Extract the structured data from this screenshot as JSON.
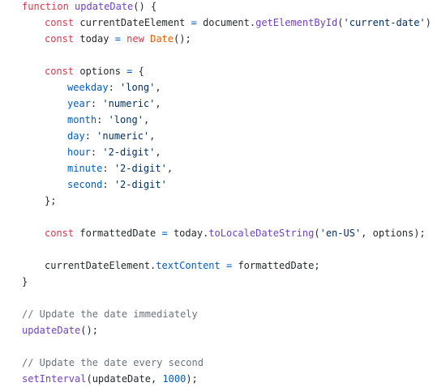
{
  "editor": {
    "lines": [
      {
        "indent": 1,
        "tokens": [
          {
            "t": "kw",
            "v": "function"
          },
          {
            "t": "txt",
            "v": " "
          },
          {
            "t": "fn",
            "v": "updateDate"
          },
          {
            "t": "txt",
            "v": "() {"
          }
        ]
      },
      {
        "indent": 2,
        "tokens": [
          {
            "t": "kw",
            "v": "const"
          },
          {
            "t": "txt",
            "v": " currentDateElement "
          },
          {
            "t": "op",
            "v": "="
          },
          {
            "t": "txt",
            "v": " document."
          },
          {
            "t": "fn",
            "v": "getElementById"
          },
          {
            "t": "txt",
            "v": "("
          },
          {
            "t": "str",
            "v": "'current-date'"
          },
          {
            "t": "txt",
            "v": ");"
          }
        ]
      },
      {
        "indent": 2,
        "tokens": [
          {
            "t": "kw",
            "v": "const"
          },
          {
            "t": "txt",
            "v": " today "
          },
          {
            "t": "op",
            "v": "="
          },
          {
            "t": "txt",
            "v": " "
          },
          {
            "t": "kw",
            "v": "new"
          },
          {
            "t": "txt",
            "v": " "
          },
          {
            "t": "cls",
            "v": "Date"
          },
          {
            "t": "txt",
            "v": "();"
          }
        ]
      },
      {
        "indent": 0,
        "tokens": []
      },
      {
        "indent": 2,
        "tokens": [
          {
            "t": "kw",
            "v": "const"
          },
          {
            "t": "txt",
            "v": " options "
          },
          {
            "t": "op",
            "v": "="
          },
          {
            "t": "txt",
            "v": " {"
          }
        ]
      },
      {
        "indent": 3,
        "tokens": [
          {
            "t": "prop",
            "v": "weekday"
          },
          {
            "t": "txt",
            "v": ": "
          },
          {
            "t": "str",
            "v": "'long'"
          },
          {
            "t": "txt",
            "v": ","
          }
        ]
      },
      {
        "indent": 3,
        "tokens": [
          {
            "t": "prop",
            "v": "year"
          },
          {
            "t": "txt",
            "v": ": "
          },
          {
            "t": "str",
            "v": "'numeric'"
          },
          {
            "t": "txt",
            "v": ","
          }
        ]
      },
      {
        "indent": 3,
        "tokens": [
          {
            "t": "prop",
            "v": "month"
          },
          {
            "t": "txt",
            "v": ": "
          },
          {
            "t": "str",
            "v": "'long'"
          },
          {
            "t": "txt",
            "v": ","
          }
        ]
      },
      {
        "indent": 3,
        "tokens": [
          {
            "t": "prop",
            "v": "day"
          },
          {
            "t": "txt",
            "v": ": "
          },
          {
            "t": "str",
            "v": "'numeric'"
          },
          {
            "t": "txt",
            "v": ","
          }
        ]
      },
      {
        "indent": 3,
        "tokens": [
          {
            "t": "prop",
            "v": "hour"
          },
          {
            "t": "txt",
            "v": ": "
          },
          {
            "t": "str",
            "v": "'2-digit'"
          },
          {
            "t": "txt",
            "v": ","
          }
        ]
      },
      {
        "indent": 3,
        "tokens": [
          {
            "t": "prop",
            "v": "minute"
          },
          {
            "t": "txt",
            "v": ": "
          },
          {
            "t": "str",
            "v": "'2-digit'"
          },
          {
            "t": "txt",
            "v": ","
          }
        ]
      },
      {
        "indent": 3,
        "tokens": [
          {
            "t": "prop",
            "v": "second"
          },
          {
            "t": "txt",
            "v": ": "
          },
          {
            "t": "str",
            "v": "'2-digit'"
          }
        ]
      },
      {
        "indent": 2,
        "tokens": [
          {
            "t": "txt",
            "v": "};"
          }
        ]
      },
      {
        "indent": 0,
        "tokens": []
      },
      {
        "indent": 2,
        "tokens": [
          {
            "t": "kw",
            "v": "const"
          },
          {
            "t": "txt",
            "v": " formattedDate "
          },
          {
            "t": "op",
            "v": "="
          },
          {
            "t": "txt",
            "v": " today."
          },
          {
            "t": "fn",
            "v": "toLocaleDateString"
          },
          {
            "t": "txt",
            "v": "("
          },
          {
            "t": "str",
            "v": "'en-US'"
          },
          {
            "t": "txt",
            "v": ", options);"
          }
        ]
      },
      {
        "indent": 0,
        "tokens": []
      },
      {
        "indent": 2,
        "tokens": [
          {
            "t": "txt",
            "v": "currentDateElement."
          },
          {
            "t": "prop",
            "v": "textContent"
          },
          {
            "t": "txt",
            "v": " "
          },
          {
            "t": "op",
            "v": "="
          },
          {
            "t": "txt",
            "v": " formattedDate;"
          }
        ]
      },
      {
        "indent": 1,
        "tokens": [
          {
            "t": "txt",
            "v": "}"
          }
        ]
      },
      {
        "indent": 0,
        "tokens": []
      },
      {
        "indent": 1,
        "tokens": [
          {
            "t": "com",
            "v": "// Update the date immediately"
          }
        ]
      },
      {
        "indent": 1,
        "tokens": [
          {
            "t": "fn",
            "v": "updateDate"
          },
          {
            "t": "txt",
            "v": "();"
          }
        ]
      },
      {
        "indent": 0,
        "tokens": []
      },
      {
        "indent": 1,
        "tokens": [
          {
            "t": "com",
            "v": "// Update the date every second"
          }
        ]
      },
      {
        "indent": 1,
        "tokens": [
          {
            "t": "fn",
            "v": "setInterval"
          },
          {
            "t": "txt",
            "v": "(updateDate, "
          },
          {
            "t": "num",
            "v": "1000"
          },
          {
            "t": "txt",
            "v": ");"
          }
        ]
      }
    ]
  }
}
